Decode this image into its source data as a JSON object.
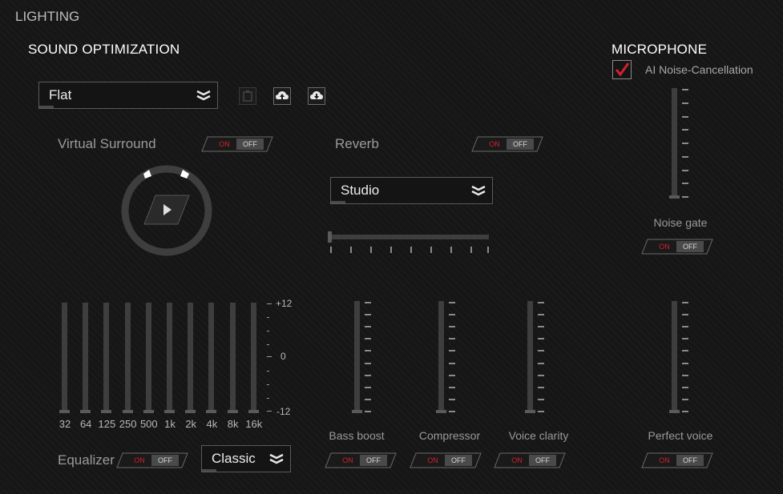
{
  "header": {
    "lighting_tab": "LIGHTING"
  },
  "sound_optimization": {
    "title": "SOUND OPTIMIZATION",
    "preset": "Flat",
    "icons": [
      "clipboard-icon",
      "cloud-upload-icon",
      "cloud-download-icon"
    ],
    "virtual_surround": {
      "label": "Virtual Surround",
      "on": "ON",
      "off": "OFF",
      "state": "off"
    },
    "reverb": {
      "label": "Reverb",
      "on": "ON",
      "off": "OFF",
      "state": "off",
      "preset": "Studio",
      "level": 0
    },
    "equalizer": {
      "label": "Equalizer",
      "on": "ON",
      "off": "OFF",
      "state": "off",
      "preset": "Classic",
      "bands": [
        "32",
        "64",
        "125",
        "250",
        "500",
        "1k",
        "2k",
        "4k",
        "8k",
        "16k"
      ],
      "scale": {
        "top": "+12",
        "mid": "0",
        "bottom": "-12"
      }
    },
    "effects": [
      {
        "label": "Bass boost",
        "on": "ON",
        "off": "OFF"
      },
      {
        "label": "Compressor",
        "on": "ON",
        "off": "OFF"
      },
      {
        "label": "Voice clarity",
        "on": "ON",
        "off": "OFF"
      }
    ]
  },
  "microphone": {
    "title": "MICROPHONE",
    "ai_noise_cancellation": {
      "label": "AI Noise-Cancellation",
      "checked": true
    },
    "noise_gate": {
      "label": "Noise gate",
      "on": "ON",
      "off": "OFF"
    },
    "perfect_voice": {
      "label": "Perfect voice",
      "on": "ON",
      "off": "OFF"
    }
  },
  "colors": {
    "accent": "#d0212e",
    "background": "#161616",
    "text": "#e6e6e6"
  }
}
